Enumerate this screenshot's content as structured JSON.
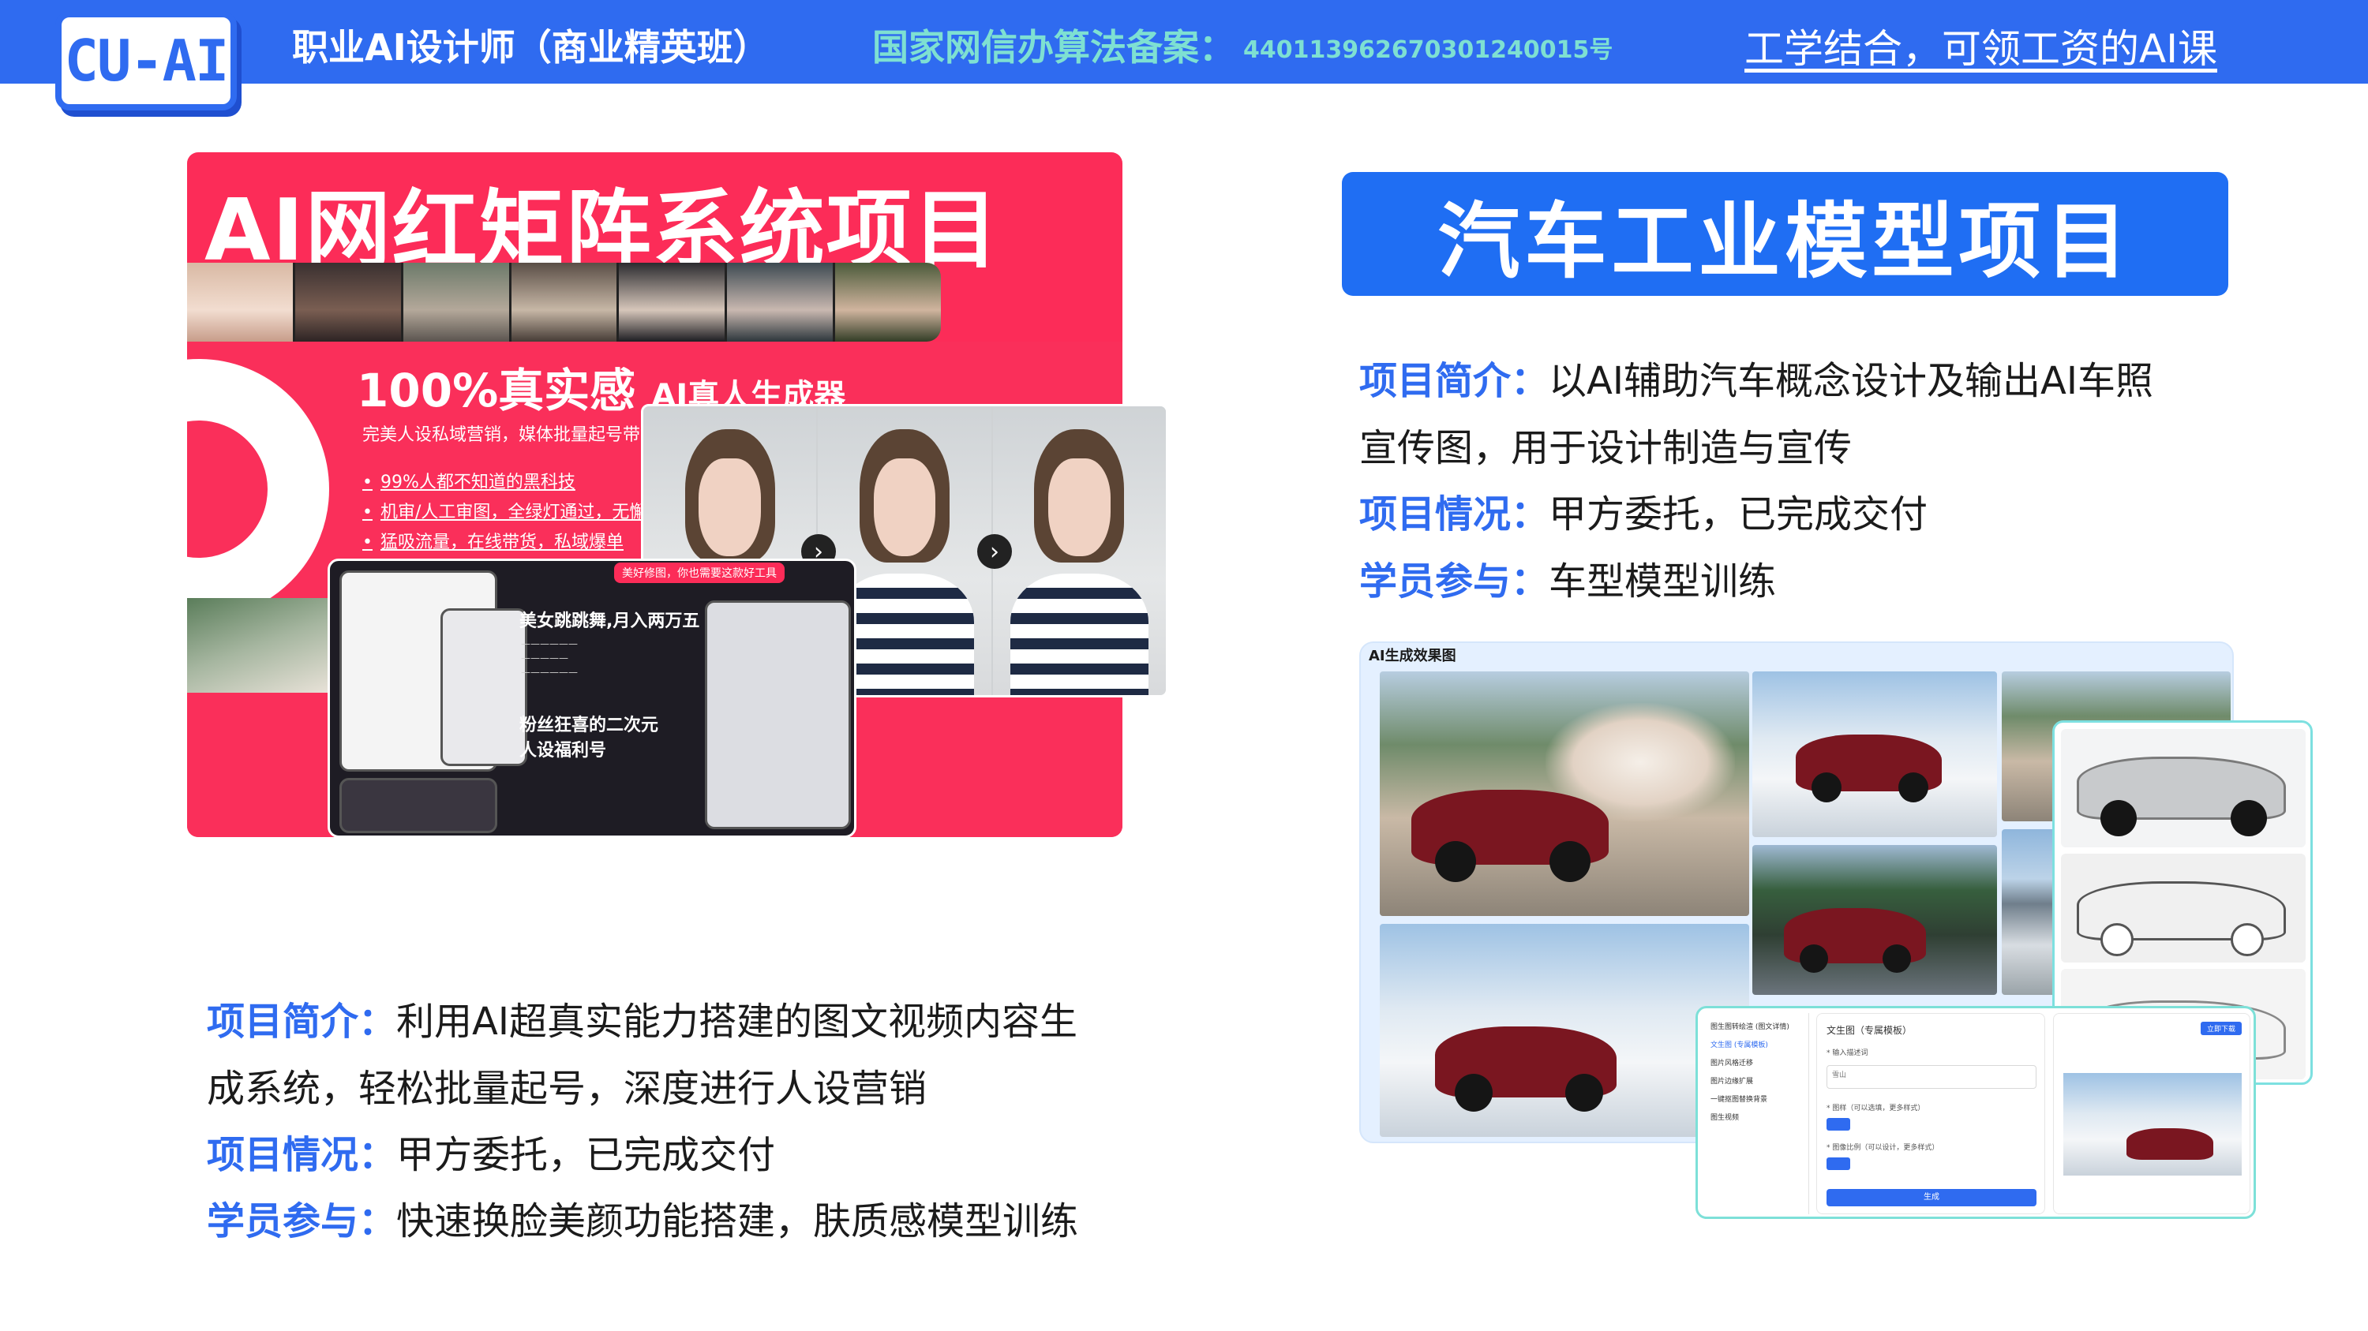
{
  "header": {
    "logo_text": "CU-AI",
    "title": "职业AI设计师（商业精英班）",
    "registration_label": "国家网信办算法备案：",
    "registration_number": "440113962670301240015号",
    "slogan": "工学结合，可领工资的AI课"
  },
  "left_project": {
    "banner_title": "AI网红矩阵系统项目",
    "headline_main": "100%真实感",
    "headline_sub": "AI真人生成器",
    "subline": "完美人设私域营销，媒体批量起号带",
    "bullets": [
      "99%人都不知道的黑科技",
      "机审/人工审图，全绿灯通过，无懈",
      "猛吸流量，在线带货，私域爆单"
    ],
    "dark_card": {
      "tag": "美好修图，你也需要这款好工具",
      "caption_1": "美女跳跳舞,月入两万五",
      "caption_2": "粉丝狂喜的二次元",
      "caption_3": "人设福利号"
    },
    "intro_label": "项目简介：",
    "intro_text_1": "利用AI超真实能力搭建的图文视频内容生",
    "intro_text_2": "成系统，轻松批量起号，深度进行人设营销",
    "status_label": "项目情况：",
    "status_text": "甲方委托，已完成交付",
    "student_label": "学员参与：",
    "student_text": "快速换脸美颜功能搭建，肤质感模型训练"
  },
  "right_project": {
    "title": "汽车工业模型项目",
    "intro_label": "项目简介：",
    "intro_text_1": "以AI辅助汽车概念设计及输出AI车照",
    "intro_text_2": "宣传图，用于设计制造与宣传",
    "status_label": "项目情况：",
    "status_text": "甲方委托，已完成交付",
    "student_label": "学员参与：",
    "student_text": "车型模型训练",
    "gallery_title": "AI生成效果图",
    "ui": {
      "sidebar_items": [
        "图生图转绘渲 (图文详情)",
        "文生图 (专属模板)",
        "图片风格迁移",
        "图片边缘扩展",
        "一键抠图替换背景",
        "图生视频"
      ],
      "form_title": "文生图（专属模板）",
      "prompt_label": "* 输入描述词",
      "prompt_value": "雪山",
      "style_label": "* 图样（可以选填，更多样式）",
      "ratio_label": "* 图像比例（可以设计，更多样式）",
      "generate_button": "生成",
      "download_button": "立即下载"
    }
  },
  "colors": {
    "brand_blue": "#2f6bf0",
    "accent_teal": "#7ee0d2",
    "pink": "#fc2c58"
  }
}
